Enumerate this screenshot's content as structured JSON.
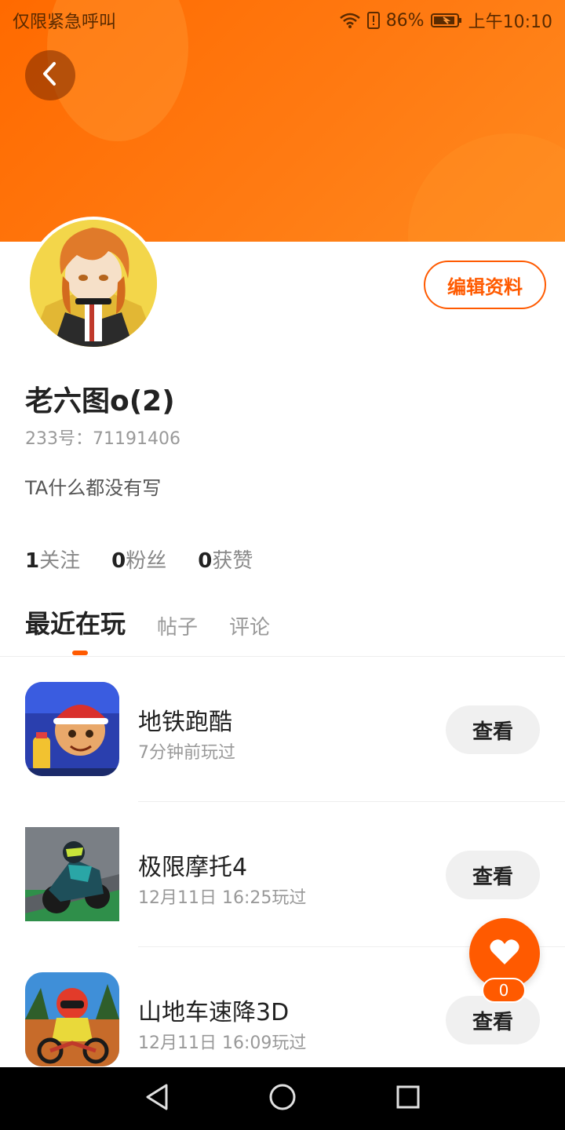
{
  "status_bar": {
    "carrier_text": "仅限紧急呼叫",
    "battery": "86%",
    "time": "上午10:10",
    "icons": [
      "wifi-icon",
      "sim-alert-icon",
      "battery-icon"
    ]
  },
  "header": {
    "back_icon": "chevron-left-icon",
    "accent_color": "#ff6a00"
  },
  "profile": {
    "edit_label": "编辑资料",
    "nickname": "老六图o(2)",
    "user_id": "233号：71191406",
    "bio": "TA什么都没有写",
    "stats": [
      {
        "count": "1",
        "label": "关注"
      },
      {
        "count": "0",
        "label": "粉丝"
      },
      {
        "count": "0",
        "label": "获赞"
      }
    ]
  },
  "tabs": [
    {
      "label": "最近在玩",
      "active": true
    },
    {
      "label": "帖子",
      "active": false
    },
    {
      "label": "评论",
      "active": false
    }
  ],
  "games": [
    {
      "title": "地铁跑酷",
      "meta": "7分钟前玩过",
      "button": "查看"
    },
    {
      "title": "极限摩托4",
      "meta": "12月11日 16:25玩过",
      "button": "查看"
    },
    {
      "title": "山地车速降3D",
      "meta": "12月11日 16:09玩过",
      "button": "查看"
    }
  ],
  "like_fab": {
    "count": "0",
    "icon": "heart-icon"
  },
  "nav_bar": {
    "icons": [
      "back-triangle-icon",
      "home-circle-icon",
      "recents-square-icon"
    ]
  }
}
